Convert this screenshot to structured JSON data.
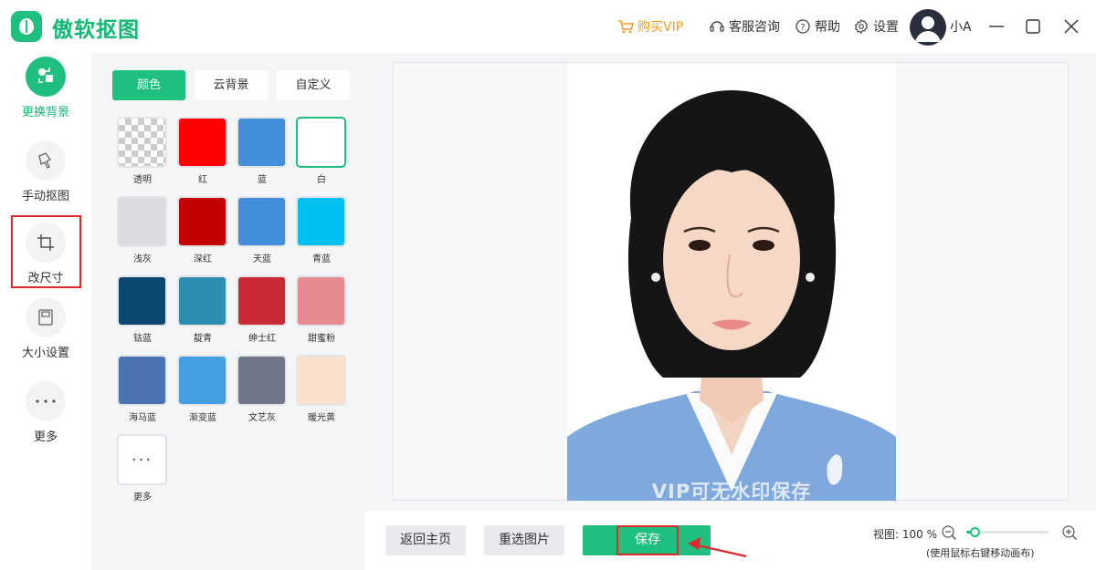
{
  "app": {
    "title": "傲软抠图"
  },
  "titlebar": {
    "vip_label": "购买VIP",
    "kefu_label": "客服咨询",
    "help_label": "帮助",
    "settings_label": "设置",
    "username": "小A"
  },
  "tools": [
    {
      "label": "更换背景",
      "icon": "change-background-icon",
      "active": true
    },
    {
      "label": "手动抠图",
      "icon": "manual-cutout-icon",
      "active": false
    },
    {
      "label": "改尺寸",
      "icon": "crop-icon",
      "active": false
    },
    {
      "label": "大小设置",
      "icon": "size-settings-icon",
      "active": false
    },
    {
      "label": "更多",
      "icon": "more-dots-icon",
      "active": false
    }
  ],
  "tabs": [
    {
      "label": "颜色",
      "active": true
    },
    {
      "label": "云背景",
      "active": false
    },
    {
      "label": "自定义",
      "active": false
    }
  ],
  "swatches": [
    {
      "label": "透明",
      "color": "transparent"
    },
    {
      "label": "红",
      "color": "#ff0000"
    },
    {
      "label": "蓝",
      "color": "#438edb"
    },
    {
      "label": "白",
      "color": "#ffffff",
      "selected": true
    },
    {
      "label": "浅灰",
      "color": "#dcdce0"
    },
    {
      "label": "深红",
      "color": "#c20000"
    },
    {
      "label": "天蓝",
      "color": "#438edb"
    },
    {
      "label": "青蓝",
      "color": "#00bff3"
    },
    {
      "label": "钴蓝",
      "color": "#0b476f"
    },
    {
      "label": "靛青",
      "color": "#2e8db0"
    },
    {
      "label": "绅士红",
      "color": "#c92a36"
    },
    {
      "label": "甜蜜粉",
      "color": "#e58a91"
    },
    {
      "label": "海马蓝",
      "color": "#4a73b1"
    },
    {
      "label": "渐变蓝",
      "color": "#449fe0"
    },
    {
      "label": "文艺灰",
      "color": "#6f7788"
    },
    {
      "label": "暖光黄",
      "color": "#fbe1cd"
    },
    {
      "label": "更多",
      "color": "more"
    }
  ],
  "preview": {
    "watermark": "VIP可无水印保存"
  },
  "bottom": {
    "home_label": "返回主页",
    "reselect_label": "重选图片",
    "save_label": "保存",
    "zoom_label": "视图: 100 %",
    "zoom_hint": "(使用鼠标右键移动画布)",
    "zoom_level": 0.06
  },
  "colors": {
    "accent": "#1fc07f",
    "vip": "#f29b16",
    "highlight": "#e0292a"
  }
}
